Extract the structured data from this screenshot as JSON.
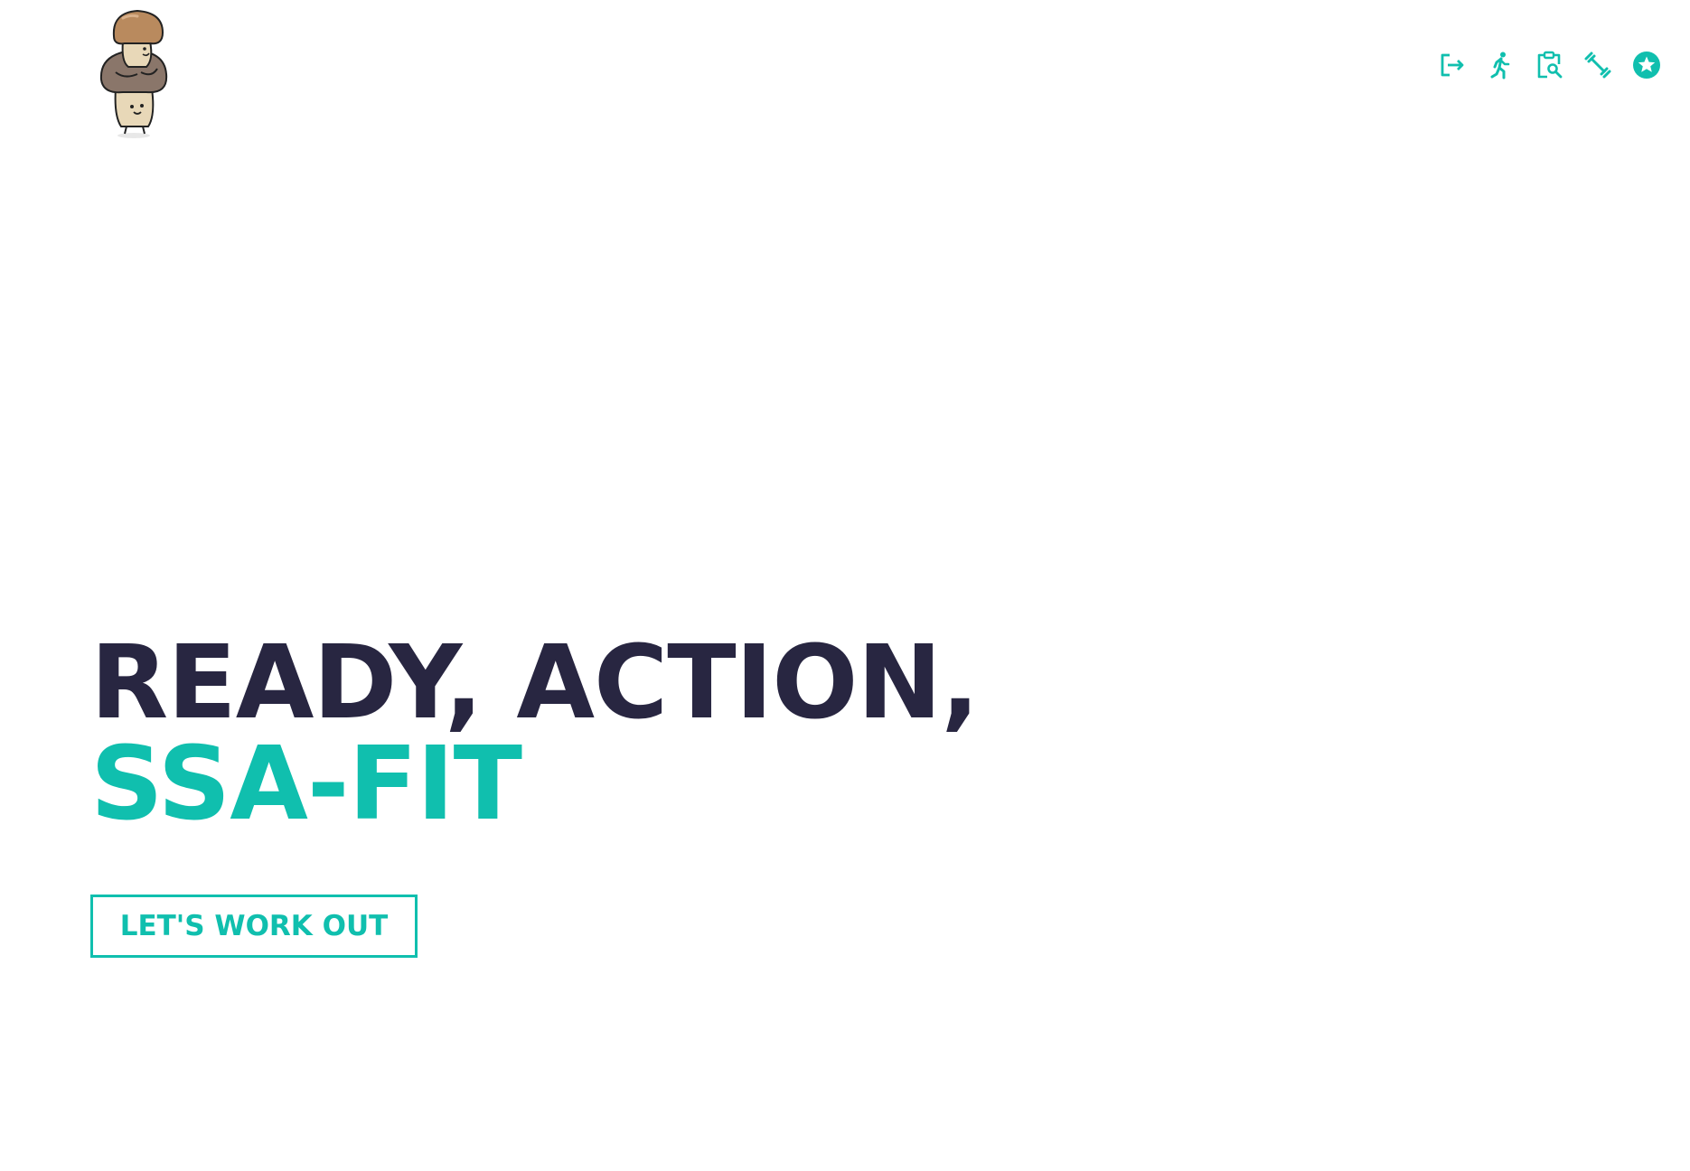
{
  "theme": {
    "accent_color": "#10bfae",
    "heading_color": "#282641",
    "background_color": "#ffffff"
  },
  "header": {
    "logo": {
      "icon": "mushroom-mascot-logo"
    },
    "nav": [
      {
        "icon": "logout-icon"
      },
      {
        "icon": "running-person-icon"
      },
      {
        "icon": "clipboard-search-icon"
      },
      {
        "icon": "dumbbell-icon"
      },
      {
        "icon": "star-badge-icon"
      }
    ]
  },
  "hero": {
    "line1": "READY, ACTION,",
    "line2": "SSA-FIT",
    "cta_label": "LET'S WORK OUT"
  }
}
